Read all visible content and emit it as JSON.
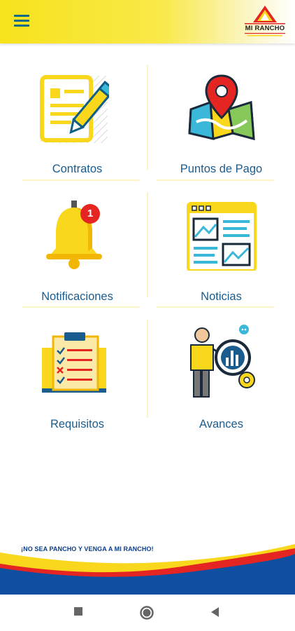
{
  "header": {
    "menu_icon": "hamburger-menu-icon",
    "logo_text": "MI RANCHO",
    "colors": {
      "bar": "#f7e21c",
      "menu": "#0a6c86"
    }
  },
  "menu": {
    "items": [
      {
        "label": "Contratos",
        "icon": "contract-pen-icon"
      },
      {
        "label": "Puntos de Pago",
        "icon": "map-pin-icon"
      },
      {
        "label": "Notificaciones",
        "icon": "bell-icon",
        "badge": "1"
      },
      {
        "label": "Noticias",
        "icon": "news-icon"
      },
      {
        "label": "Requisitos",
        "icon": "clipboard-checklist-icon"
      },
      {
        "label": "Avances",
        "icon": "analytics-person-icon"
      }
    ],
    "label_color": "#1b5c8e"
  },
  "footer": {
    "slogan": "¡NO SEA PANCHO Y VENGA A MI RANCHO!",
    "colors": {
      "yellow": "#f9d71c",
      "blue": "#0f4fa2",
      "red": "#e52521"
    }
  },
  "navbar": {
    "recents_icon": "square-recents-icon",
    "home_icon": "circle-home-icon",
    "back_icon": "triangle-back-icon"
  }
}
